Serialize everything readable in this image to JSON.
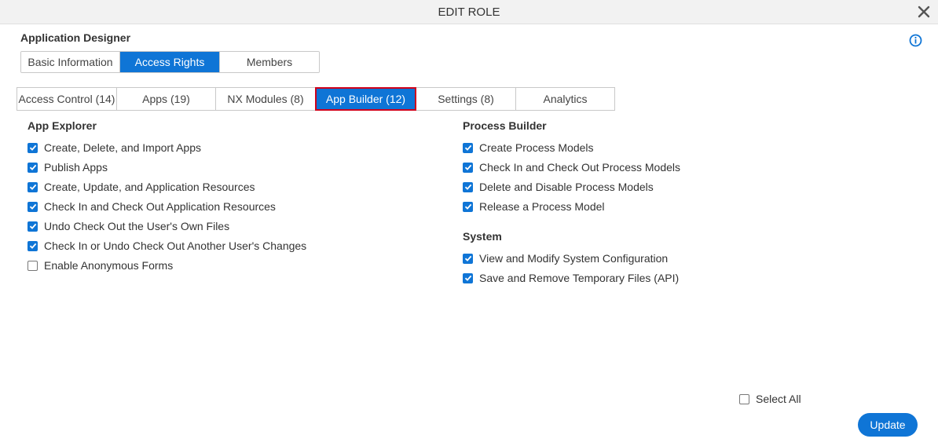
{
  "dialog": {
    "title": "EDIT ROLE",
    "close_icon": "close-icon",
    "info_icon": "info-icon"
  },
  "role_name": "Application Designer",
  "main_tabs": [
    {
      "label": "Basic Information",
      "active": false
    },
    {
      "label": "Access Rights",
      "active": true
    },
    {
      "label": "Members",
      "active": false
    }
  ],
  "sub_tabs": [
    {
      "label": "Access Control (14)",
      "active": false
    },
    {
      "label": "Apps (19)",
      "active": false
    },
    {
      "label": "NX Modules (8)",
      "active": false
    },
    {
      "label": "App Builder (12)",
      "active": true
    },
    {
      "label": "Settings (8)",
      "active": false
    },
    {
      "label": "Analytics",
      "active": false
    }
  ],
  "sections": {
    "app_explorer": {
      "title": "App Explorer",
      "items": [
        {
          "label": "Create, Delete, and Import Apps",
          "checked": true
        },
        {
          "label": "Publish Apps",
          "checked": true
        },
        {
          "label": "Create, Update, and Application Resources",
          "checked": true
        },
        {
          "label": "Check In and Check Out Application Resources",
          "checked": true
        },
        {
          "label": "Undo Check Out the User's Own Files",
          "checked": true
        },
        {
          "label": "Check In or Undo Check Out Another User's Changes",
          "checked": true
        },
        {
          "label": "Enable Anonymous Forms",
          "checked": false
        }
      ]
    },
    "process_builder": {
      "title": "Process Builder",
      "items": [
        {
          "label": "Create Process Models",
          "checked": true
        },
        {
          "label": "Check In and Check Out Process Models",
          "checked": true
        },
        {
          "label": "Delete and Disable Process Models",
          "checked": true
        },
        {
          "label": "Release a Process Model",
          "checked": true
        }
      ]
    },
    "system": {
      "title": "System",
      "items": [
        {
          "label": "View and Modify System Configuration",
          "checked": true
        },
        {
          "label": "Save and Remove Temporary Files (API)",
          "checked": true
        }
      ]
    }
  },
  "select_all": {
    "label": "Select All",
    "checked": false
  },
  "update_button": {
    "label": "Update"
  },
  "colors": {
    "accent": "#0f75d6",
    "highlight_border": "#d0021b",
    "titlebar_bg": "#f2f2f2"
  }
}
